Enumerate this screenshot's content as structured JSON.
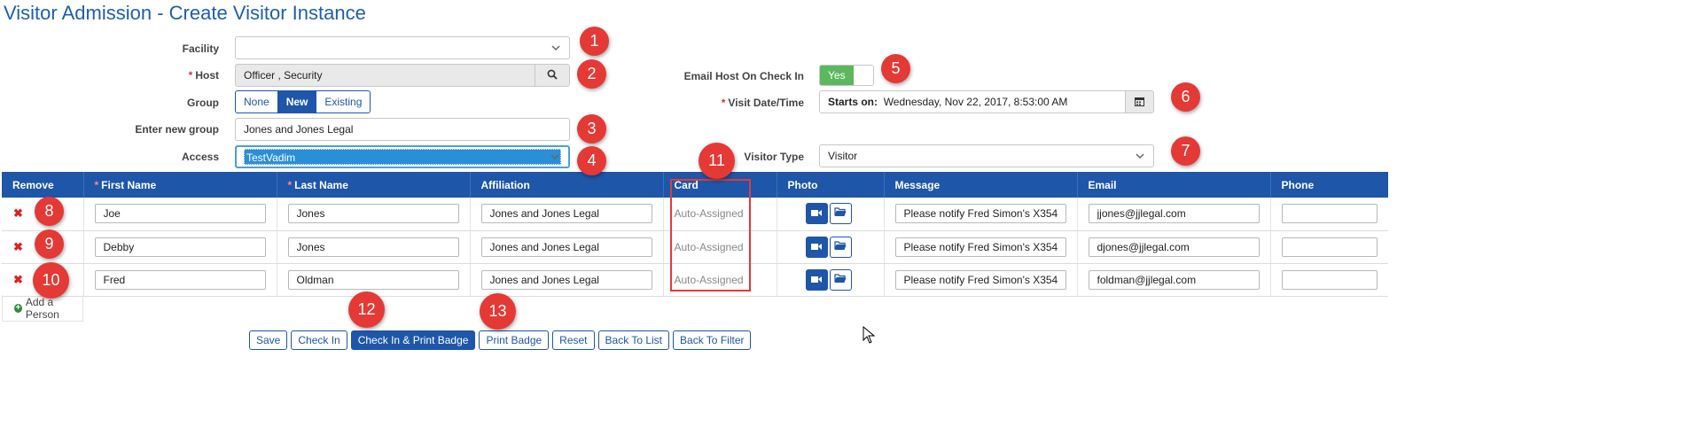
{
  "page": {
    "title": "Visitor Admission - Create Visitor Instance"
  },
  "form": {
    "facility": {
      "label": "Facility",
      "value": ""
    },
    "host": {
      "label": "Host",
      "value": "Officer , Security"
    },
    "group": {
      "label": "Group",
      "options": [
        "None",
        "New",
        "Existing"
      ],
      "selected": "New"
    },
    "new_group": {
      "label": "Enter new group",
      "value": "Jones and Jones Legal"
    },
    "access": {
      "label": "Access",
      "value": "TestVadim"
    },
    "email_host": {
      "label": "Email Host On Check In",
      "value": "Yes"
    },
    "visit_date": {
      "label": "Visit Date/Time",
      "prefix": "Starts on:",
      "value": "Wednesday, Nov 22, 2017, 8:53:00 AM"
    },
    "visitor_type": {
      "label": "Visitor Type",
      "value": "Visitor"
    }
  },
  "table": {
    "columns": [
      "Remove",
      "First Name",
      "Last Name",
      "Affiliation",
      "Card",
      "Photo",
      "Message",
      "Email",
      "Phone"
    ],
    "rows": [
      {
        "first": "Joe",
        "last": "Jones",
        "affiliation": "Jones and Jones Legal",
        "card": "Auto-Assigned",
        "message": "Please notify Fred Simon's X354",
        "email": "jjones@jjlegal.com",
        "phone": ""
      },
      {
        "first": "Debby",
        "last": "Jones",
        "affiliation": "Jones and Jones Legal",
        "card": "Auto-Assigned",
        "message": "Please notify Fred Simon's X354",
        "email": "djones@jjlegal.com",
        "phone": ""
      },
      {
        "first": "Fred",
        "last": "Oldman",
        "affiliation": "Jones and Jones Legal",
        "card": "Auto-Assigned",
        "message": "Please notify Fred Simon's X354",
        "email": "foldman@jjlegal.com",
        "phone": ""
      }
    ],
    "add_person": "Add a Person"
  },
  "actions": [
    "Save",
    "Check In",
    "Check In & Print Badge",
    "Print Badge",
    "Reset",
    "Back To List",
    "Back To Filter"
  ],
  "markers": [
    "1",
    "2",
    "3",
    "4",
    "5",
    "6",
    "7",
    "8",
    "9",
    "10",
    "11",
    "12",
    "13"
  ],
  "colors": {
    "primary": "#1e56a9",
    "marker": "#e53935",
    "toggle_on": "#5cb85c",
    "title": "#1f5fae"
  }
}
